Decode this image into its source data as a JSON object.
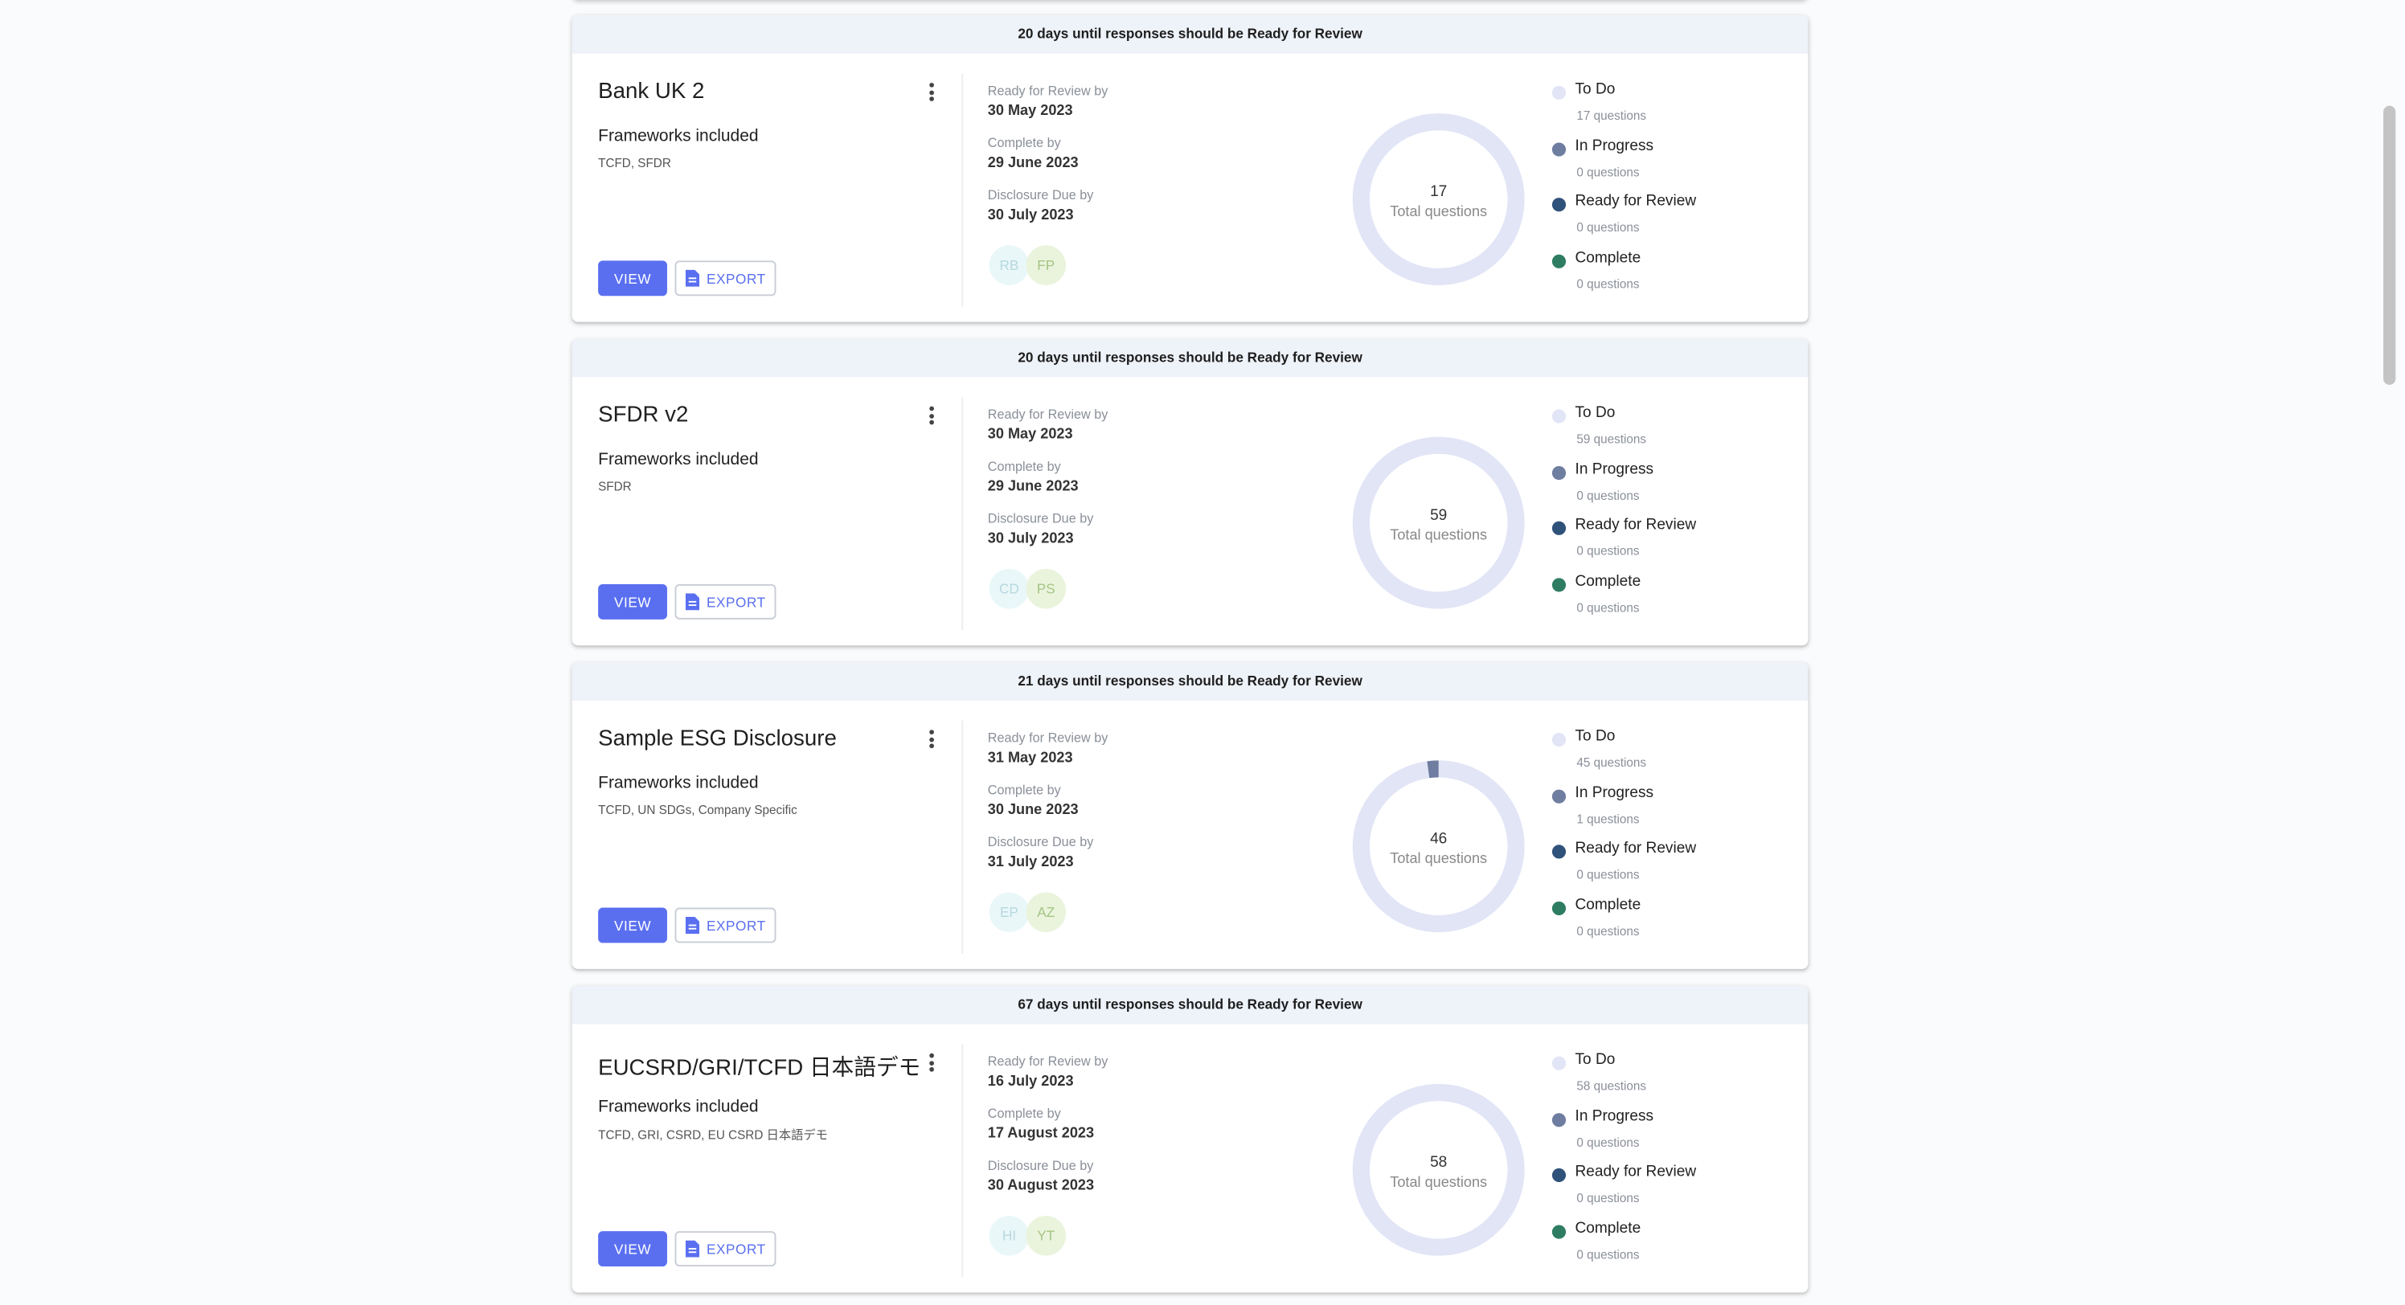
{
  "colors": {
    "accent": "#5a6ff0",
    "status_todo": "#e1e5f6",
    "status_in_progress": "#6e7da0",
    "status_ready": "#2f527a",
    "status_complete": "#2e7d62",
    "banner_bg": "#eef2f9"
  },
  "labels": {
    "frameworks": "Frameworks included",
    "view": "VIEW",
    "export": "EXPORT",
    "ready_by": "Ready for Review by",
    "complete_by": "Complete by",
    "disclosure_due_by": "Disclosure Due by",
    "total_questions": "Total questions",
    "todo": "To Do",
    "in_progress": "In Progress",
    "ready": "Ready for Review",
    "complete": "Complete"
  },
  "icons": {
    "menu": "kebab-vertical-icon",
    "export": "document-icon"
  },
  "cards": [
    {
      "banner": "20 days until responses should be Ready for Review",
      "title": "Bank UK 2",
      "frameworks": "TCFD, SFDR",
      "ready_date": "30 May 2023",
      "complete_date": "29 June 2023",
      "due_date": "30 July 2023",
      "avatars": [
        "RB",
        "FP"
      ],
      "total": "17",
      "counts": {
        "todo": 17,
        "in_progress": 0,
        "ready": 0,
        "complete": 0
      },
      "count_text": {
        "todo": "17 questions",
        "in_progress": "0 questions",
        "ready": "0 questions",
        "complete": "0 questions"
      }
    },
    {
      "banner": "20 days until responses should be Ready for Review",
      "title": "SFDR v2",
      "frameworks": "SFDR",
      "ready_date": "30 May 2023",
      "complete_date": "29 June 2023",
      "due_date": "30 July 2023",
      "avatars": [
        "CD",
        "PS"
      ],
      "total": "59",
      "counts": {
        "todo": 59,
        "in_progress": 0,
        "ready": 0,
        "complete": 0
      },
      "count_text": {
        "todo": "59 questions",
        "in_progress": "0 questions",
        "ready": "0 questions",
        "complete": "0 questions"
      }
    },
    {
      "banner": "21 days until responses should be Ready for Review",
      "title": "Sample ESG Disclosure",
      "frameworks": "TCFD, UN SDGs, Company Specific",
      "ready_date": "31 May 2023",
      "complete_date": "30 June 2023",
      "due_date": "31 July 2023",
      "avatars": [
        "EP",
        "AZ"
      ],
      "total": "46",
      "counts": {
        "todo": 45,
        "in_progress": 1,
        "ready": 0,
        "complete": 0
      },
      "count_text": {
        "todo": "45 questions",
        "in_progress": "1 questions",
        "ready": "0 questions",
        "complete": "0 questions"
      }
    },
    {
      "banner": "67 days until responses should be Ready for Review",
      "title": "EUCSRD/GRI/TCFD 日本語デモ",
      "frameworks": "TCFD, GRI, CSRD, EU CSRD 日本語デモ",
      "ready_date": "16 July 2023",
      "complete_date": "17 August 2023",
      "due_date": "30 August 2023",
      "avatars": [
        "HI",
        "YT"
      ],
      "total": "58",
      "counts": {
        "todo": 58,
        "in_progress": 0,
        "ready": 0,
        "complete": 0
      },
      "count_text": {
        "todo": "58 questions",
        "in_progress": "0 questions",
        "ready": "0 questions",
        "complete": "0 questions"
      }
    }
  ]
}
